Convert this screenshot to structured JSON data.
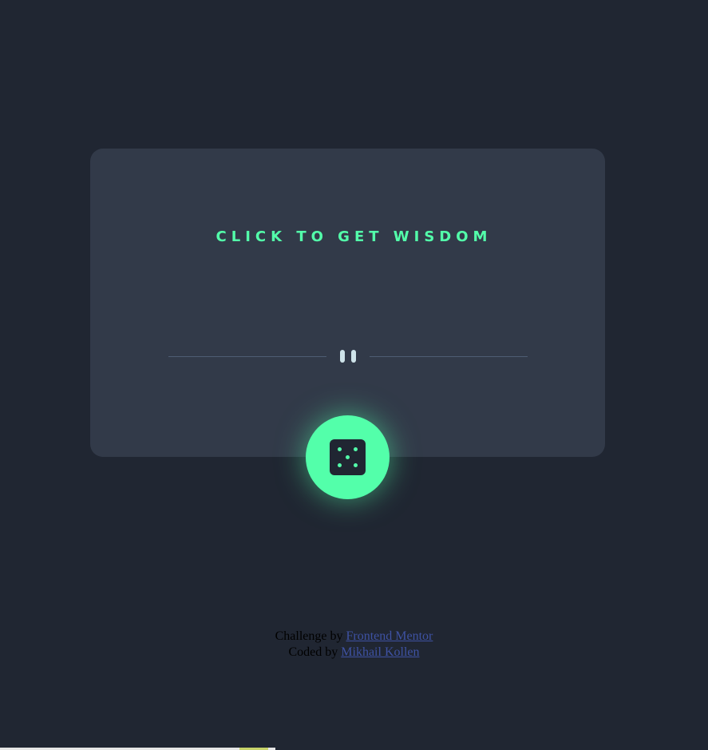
{
  "advice": {
    "text": "CLICK TO GET WISDOM"
  },
  "divider": {
    "icon": "pause-icon"
  },
  "dice_button": {
    "icon": "dice-icon",
    "accent": "#53ffaa"
  },
  "attribution": {
    "challenge_prefix": "Challenge by",
    "challenge_link": "Frontend Mentor",
    "coded_prefix": "Coded by",
    "coded_link": "Mikhail Kollen"
  },
  "colors": {
    "background": "#202632",
    "card": "#323a49",
    "accent": "#53ffaa",
    "divider_line": "#4f5d74",
    "pause_bars": "#cee3e9",
    "link": "#3e52a3"
  }
}
